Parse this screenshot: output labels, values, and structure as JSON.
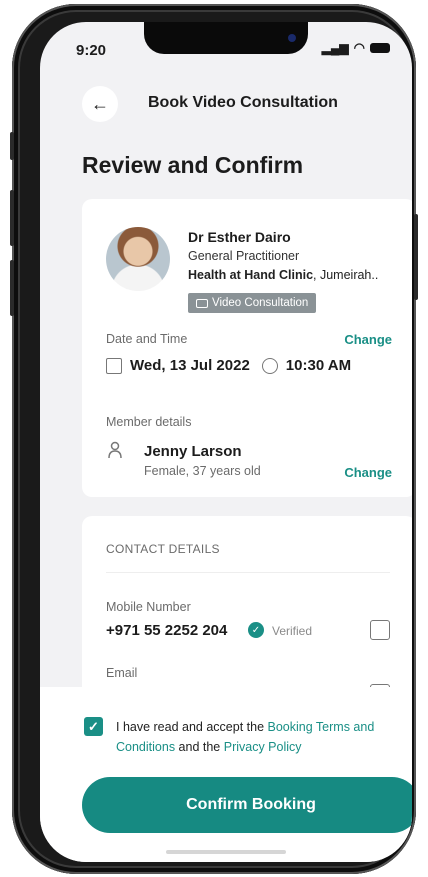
{
  "status_bar": {
    "time": "9:20"
  },
  "header": {
    "title": "Book Video Consultation"
  },
  "page": {
    "title": "Review and Confirm"
  },
  "doctor": {
    "name": "Dr Esther Dairo",
    "role": "General Practitioner",
    "clinic_name": "Health at Hand Clinic",
    "clinic_location": ", Jumeirah..",
    "consultation_type": "Video Consultation"
  },
  "date_time": {
    "label": "Date and Time",
    "change_label": "Change",
    "date": "Wed, 13 Jul 2022",
    "time": "10:30 AM"
  },
  "member": {
    "label": "Member details",
    "name": "Jenny Larson",
    "info": "Female, 37 years old",
    "change_label": "Change"
  },
  "contact": {
    "section_title": "CONTACT DETAILS",
    "mobile_label": "Mobile Number",
    "mobile_value": "+971 55 2252 204",
    "verified_label": "Verified",
    "email_label": "Email"
  },
  "terms": {
    "prefix": "I have read and accept the ",
    "booking_terms_link": "Booking Terms and Conditions",
    "middle": " and the ",
    "privacy_link": "Privacy Policy",
    "checked": true
  },
  "actions": {
    "confirm_label": "Confirm Booking"
  },
  "colors": {
    "accent": "#1a8f86",
    "background": "#f2f2f4",
    "badge": "#8a9296"
  }
}
